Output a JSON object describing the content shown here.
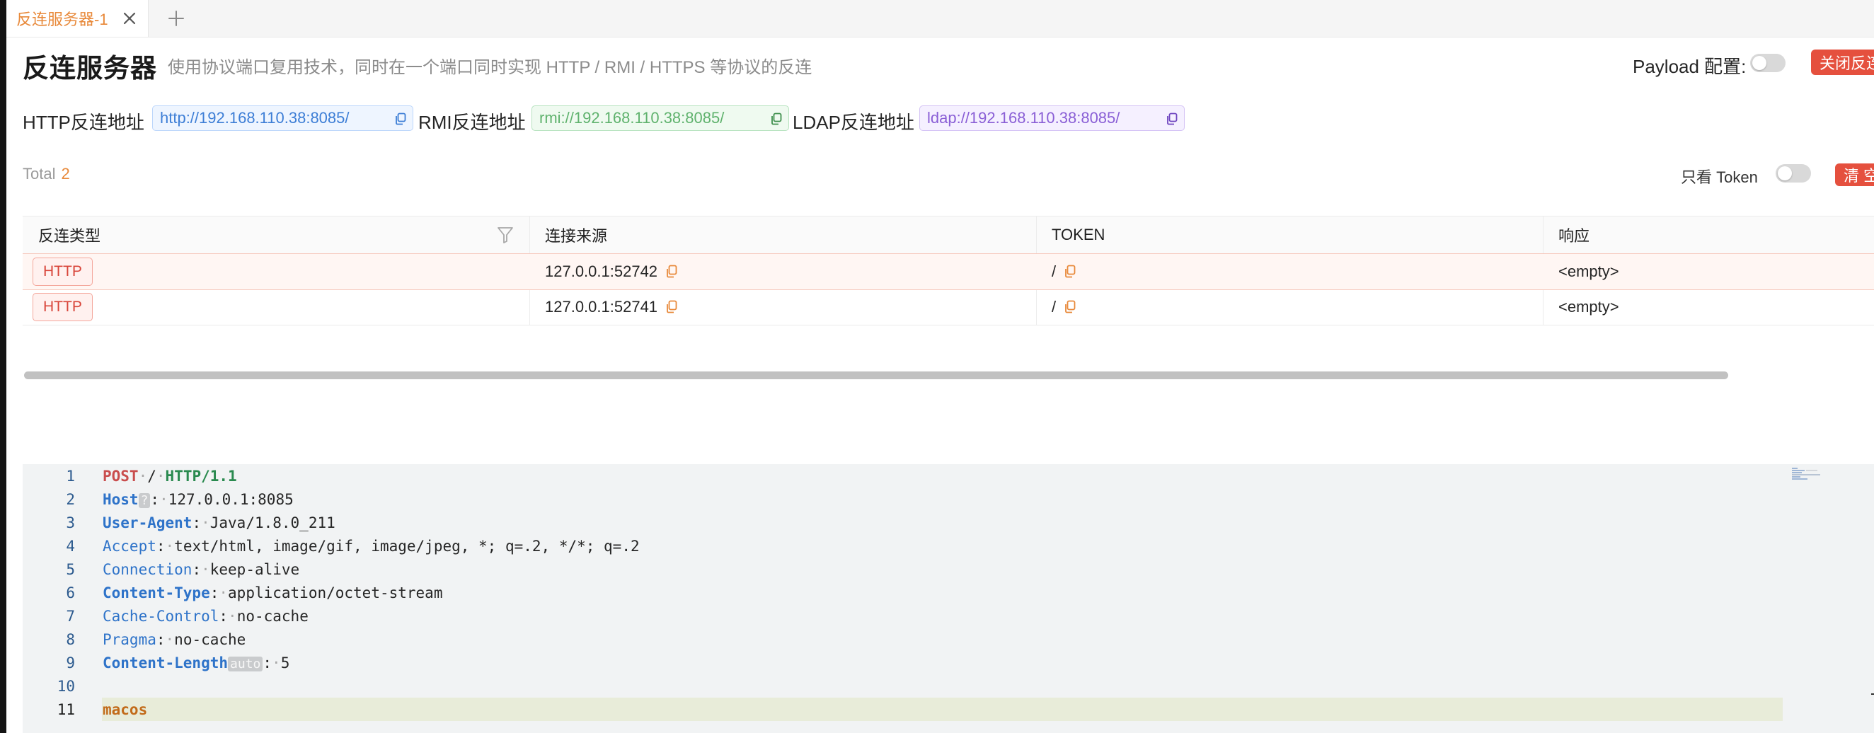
{
  "tab": {
    "label": "反连服务器-1"
  },
  "header": {
    "title": "反连服务器",
    "description": "使用协议端口复用技术，同时在一个端口同时实现 HTTP / RMI / HTTPS 等协议的反连",
    "payload_label": "Payload 配置:",
    "payload_enabled": false,
    "close_button": "关闭反连"
  },
  "addresses": [
    {
      "label": "HTTP反连地址",
      "value": "http://192.168.110.38:8085/",
      "color": "#3d7ed6"
    },
    {
      "label": "RMI反连地址",
      "value": "rmi://192.168.110.38:8085/",
      "color": "#5fb26d"
    },
    {
      "label": "LDAP反连地址",
      "value": "ldap://192.168.110.38:8085/",
      "color": "#8a5fd6"
    }
  ],
  "summary": {
    "total_label": "Total",
    "total_count": "2",
    "token_only_label": "只看 Token",
    "token_only_enabled": false,
    "clear_button": "清 空"
  },
  "table": {
    "columns": [
      "反连类型",
      "连接来源",
      "TOKEN",
      "响应"
    ],
    "rows": [
      {
        "type": "HTTP",
        "source": "127.0.0.1:52742",
        "token": "/",
        "response": "<empty>",
        "selected": true
      },
      {
        "type": "HTTP",
        "source": "127.0.0.1:52741",
        "token": "/",
        "response": "<empty>",
        "selected": false
      }
    ]
  },
  "editor": {
    "line_numbers": [
      "1",
      "2",
      "3",
      "4",
      "5",
      "6",
      "7",
      "8",
      "9",
      "10",
      "11"
    ],
    "request_line": {
      "method": "POST",
      "path": "/",
      "protocol": "HTTP/1.1"
    },
    "headers": [
      {
        "name": "Host",
        "value": "127.0.0.1:8085",
        "hint": "?"
      },
      {
        "name": "User-Agent",
        "value": "Java/1.8.0_211"
      },
      {
        "name": "Accept",
        "value": "text/html, image/gif, image/jpeg, *; q=.2, */*; q=.2"
      },
      {
        "name": "Connection",
        "value": "keep-alive"
      },
      {
        "name": "Content-Type",
        "value": "application/octet-stream"
      },
      {
        "name": "Cache-Control",
        "value": "no-cache"
      },
      {
        "name": "Pragma",
        "value": "no-cache"
      },
      {
        "name": "Content-Length",
        "value": "5",
        "hint": "auto"
      }
    ],
    "body": "macos",
    "current_line": "11"
  },
  "icons": {
    "tab_close": "close-icon",
    "tab_add": "plus-icon",
    "copy": "copy-icon",
    "filter": "filter-icon"
  }
}
